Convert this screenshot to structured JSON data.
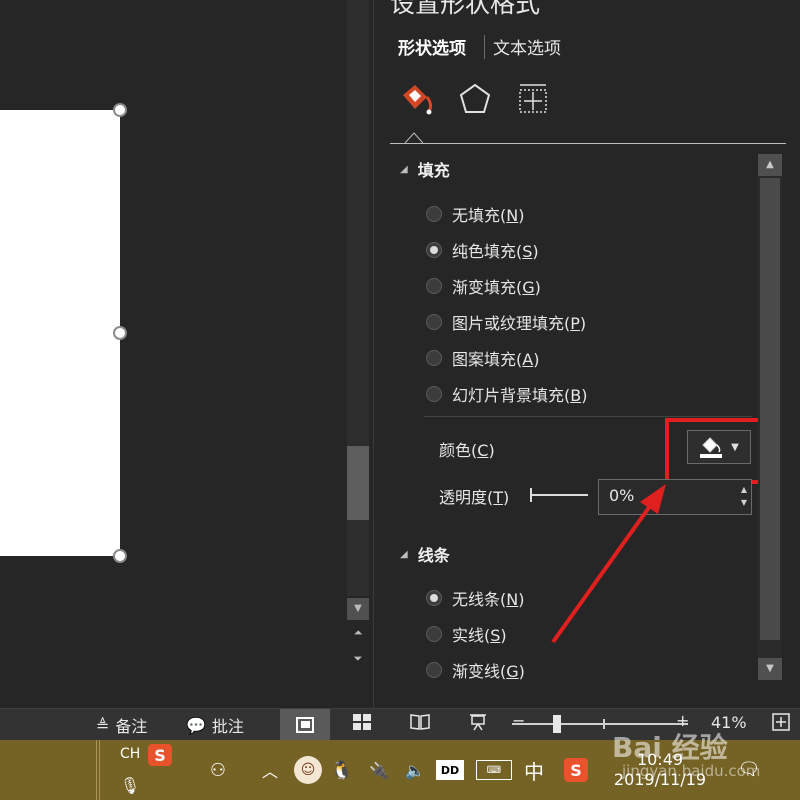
{
  "pane": {
    "title": "设置形状格式",
    "tabs": {
      "shape_options": "形状选项",
      "text_options": "文本选项"
    },
    "icons": [
      "fill-line-icon",
      "effects-pentagon-icon",
      "size-properties-icon"
    ]
  },
  "fill_section": {
    "title": "填充",
    "options": [
      {
        "label": "无填充",
        "key": "N",
        "selected": false
      },
      {
        "label": "纯色填充",
        "key": "S",
        "selected": true
      },
      {
        "label": "渐变填充",
        "key": "G",
        "selected": false
      },
      {
        "label": "图片或纹理填充",
        "key": "P",
        "selected": false
      },
      {
        "label": "图案填充",
        "key": "A",
        "selected": false
      },
      {
        "label": "幻灯片背景填充",
        "key": "B",
        "selected": false
      }
    ],
    "color": {
      "label": "颜色",
      "key": "C"
    },
    "transparency": {
      "label": "透明度",
      "key": "T",
      "value": "0%"
    }
  },
  "line_section": {
    "title": "线条",
    "options": [
      {
        "label": "无线条",
        "key": "N",
        "selected": true
      },
      {
        "label": "实线",
        "key": "S",
        "selected": false
      },
      {
        "label": "渐变线",
        "key": "G",
        "selected": false
      }
    ]
  },
  "status_bar": {
    "notes": "备注",
    "comments": "批注",
    "zoom": "41%"
  },
  "taskbar": {
    "ime_lang": "CH",
    "ime_mode": "中",
    "time": "10:49",
    "date": "2019/11/19"
  },
  "watermark": {
    "text": "Bai 经验",
    "url": "jingyan.baidu.com"
  },
  "colors": {
    "highlight": "#e0201e",
    "taskbar": "#756225",
    "pane_bg": "#262626"
  }
}
